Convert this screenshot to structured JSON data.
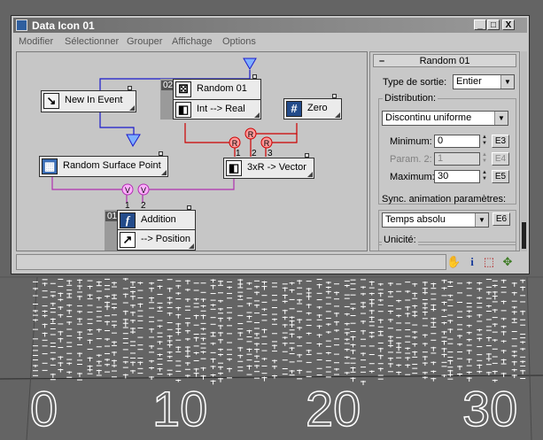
{
  "window": {
    "title": "Data Icon 01",
    "buttons": {
      "minimize": "_",
      "maximize": "□",
      "close": "X"
    }
  },
  "menu": [
    "Modifier",
    "Sélectionner",
    "Grouper",
    "Affichage",
    "Options"
  ],
  "graph": {
    "nodes": {
      "new_in_event": {
        "label": "New In Event"
      },
      "random01": {
        "number": "02",
        "label": "Random 01",
        "sub": "Int --> Real"
      },
      "zero": {
        "label": "Zero"
      },
      "random_surface_point": {
        "label": "Random Surface Point"
      },
      "vector": {
        "label": "3xR -> Vector",
        "port_labels": [
          "1",
          "2",
          "3"
        ]
      },
      "addition": {
        "number": "01",
        "label": "Addition",
        "sub": "--> Position",
        "port_labels": [
          "1",
          "2"
        ]
      }
    },
    "converters": {
      "r": "R",
      "v": "V"
    },
    "colors": {
      "blue_wire": "#1a1acc",
      "red_wire": "#cc0000",
      "purple_wire": "#b030b0"
    }
  },
  "panel": {
    "title": "Random 01",
    "type_label": "Type de sortie:",
    "type_value": "Entier",
    "distribution_label": "Distribution:",
    "distribution_value": "Discontinu uniforme",
    "minimum_label": "Minimum:",
    "minimum_value": "0",
    "minimum_btn": "E3",
    "param2_label": "Param. 2:",
    "param2_value": "1",
    "param2_btn": "E4",
    "maximum_label": "Maximum:",
    "maximum_value": "30",
    "maximum_btn": "E5",
    "sync_label": "Sync. animation paramètres:",
    "sync_value": "Temps absolu",
    "sync_btn": "E6",
    "unicity_label": "Unicité:"
  },
  "statusbar": {
    "icons": [
      "hand-icon",
      "info-icon",
      "select-region-icon",
      "navigate-icon"
    ]
  },
  "viewport": {
    "numbers": [
      "0",
      "10",
      "20",
      "30"
    ]
  }
}
